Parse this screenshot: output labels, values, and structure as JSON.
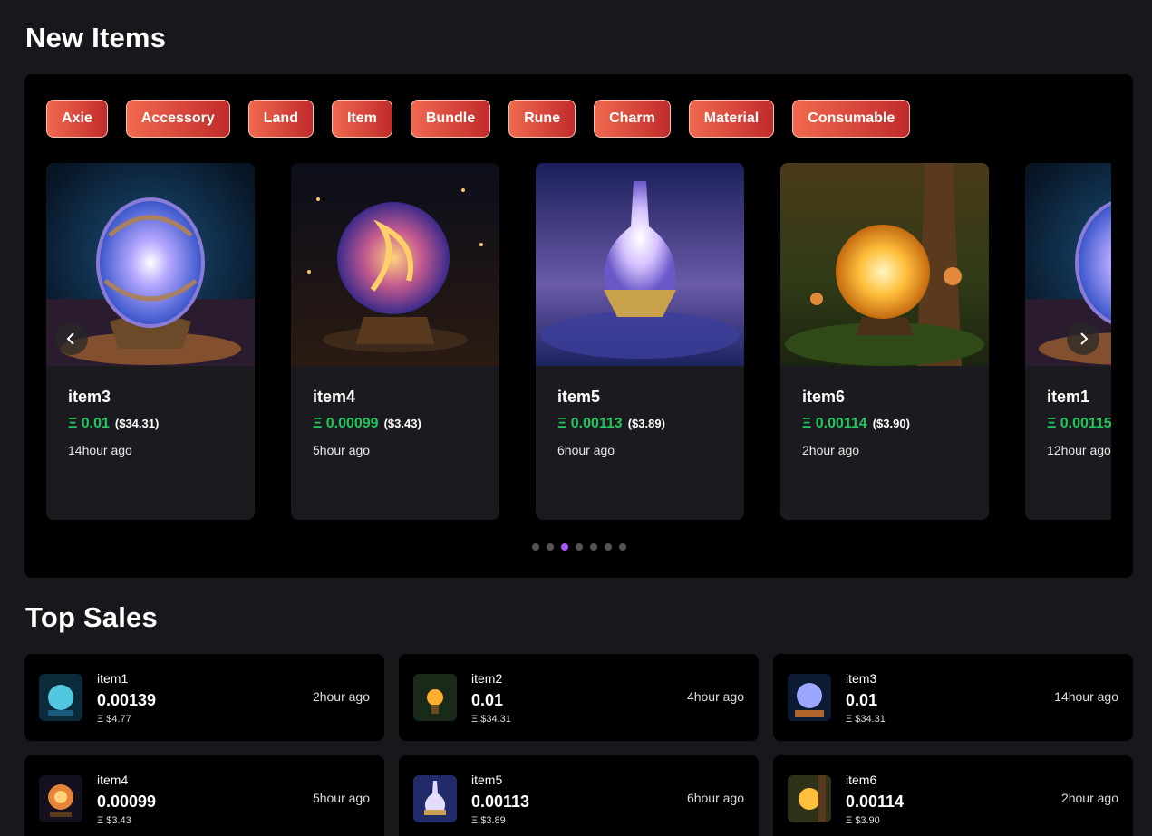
{
  "new_items": {
    "title": "New Items",
    "categories": [
      "Axie",
      "Accessory",
      "Land",
      "Item",
      "Bundle",
      "Rune",
      "Charm",
      "Material",
      "Consumable"
    ],
    "cards": [
      {
        "name": "item3",
        "price": "Ξ 0.01",
        "usd": "($34.31)",
        "time": "14hour ago",
        "art": "crystal-orb-blue"
      },
      {
        "name": "item4",
        "price": "Ξ 0.00099",
        "usd": "($3.43)",
        "time": "5hour ago",
        "art": "fire-orb"
      },
      {
        "name": "item5",
        "price": "Ξ 0.00113",
        "usd": "($3.89)",
        "time": "6hour ago",
        "art": "cosmic-lamp"
      },
      {
        "name": "item6",
        "price": "Ξ 0.00114",
        "usd": "($3.90)",
        "time": "2hour ago",
        "art": "forest-orb"
      },
      {
        "name": "item1",
        "price": "Ξ 0.00115",
        "usd": "",
        "time": "12hour ago",
        "art": "crystal-orb-blue"
      }
    ],
    "prev_icon": "chevron-left-icon",
    "next_icon": "chevron-right-icon",
    "dots": {
      "count": 7,
      "active": 2
    },
    "colors": {
      "accent_from": "#f0694f",
      "accent_to": "#c02b2b",
      "price": "#22c55e",
      "active_dot": "#a855f7"
    }
  },
  "top_sales": {
    "title": "Top Sales",
    "items": [
      {
        "name": "item1",
        "price": "0.00139",
        "usd": "Ξ $4.77",
        "time": "2hour ago",
        "art": "crystal-orb-cyan"
      },
      {
        "name": "item2",
        "price": "0.01",
        "usd": "Ξ $34.31",
        "time": "4hour ago",
        "art": "forest-lamp"
      },
      {
        "name": "item3",
        "price": "0.01",
        "usd": "Ξ $34.31",
        "time": "14hour ago",
        "art": "crystal-orb-blue"
      },
      {
        "name": "item4",
        "price": "0.00099",
        "usd": "Ξ $3.43",
        "time": "5hour ago",
        "art": "fire-orb"
      },
      {
        "name": "item5",
        "price": "0.00113",
        "usd": "Ξ $3.89",
        "time": "6hour ago",
        "art": "cosmic-lamp"
      },
      {
        "name": "item6",
        "price": "0.00114",
        "usd": "Ξ $3.90",
        "time": "2hour ago",
        "art": "forest-orb"
      }
    ]
  }
}
